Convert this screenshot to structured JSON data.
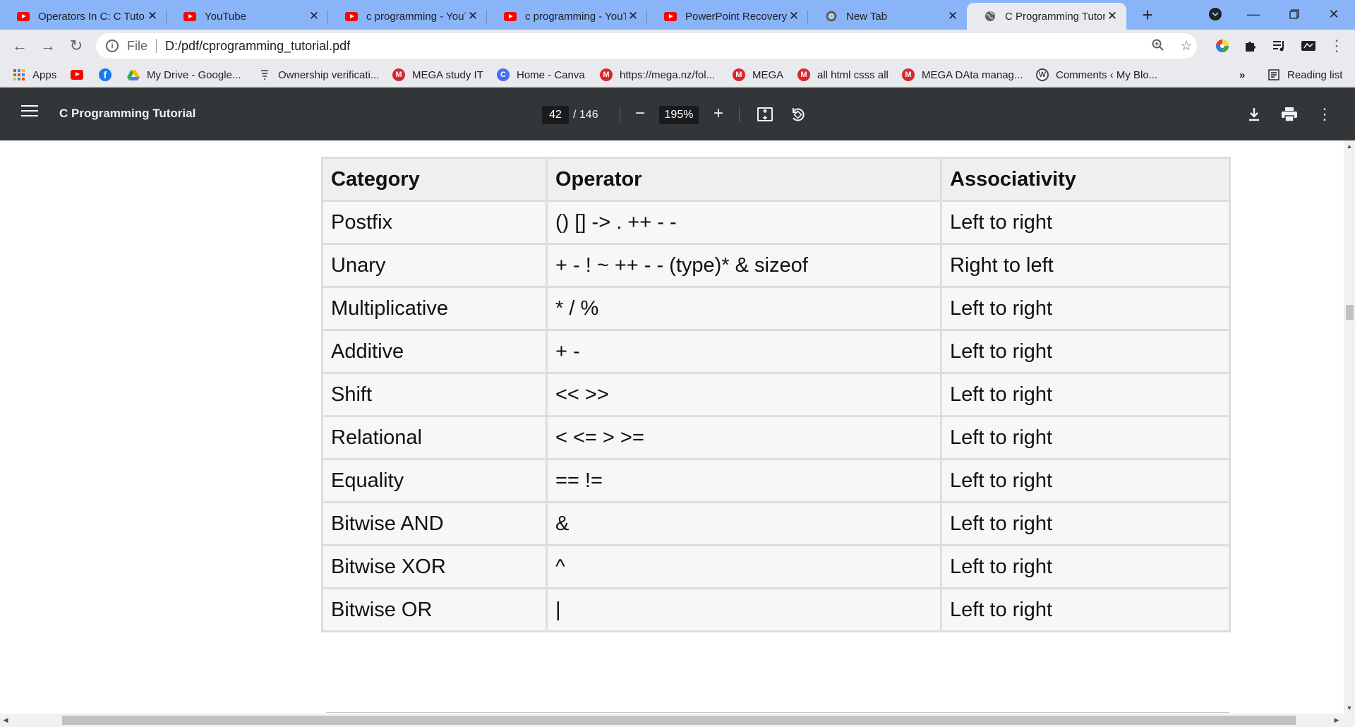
{
  "tabs": [
    {
      "title": "Operators In C: C Tuto",
      "icon": "youtube-icon"
    },
    {
      "title": "YouTube",
      "icon": "youtube-icon"
    },
    {
      "title": "c programming - YouT",
      "icon": "youtube-icon"
    },
    {
      "title": "c programming - YouT",
      "icon": "youtube-icon"
    },
    {
      "title": "PowerPoint Recovery |",
      "icon": "youtube-icon"
    },
    {
      "title": "New Tab",
      "icon": "chrome-icon"
    },
    {
      "title": "C Programming Tutor",
      "icon": "globe-icon",
      "active": true
    }
  ],
  "address": {
    "scheme": "File",
    "url": "D:/pdf/cprogramming_tutorial.pdf"
  },
  "bookmarks": [
    {
      "label": "Apps",
      "icon": "apps-grid-icon"
    },
    {
      "label": "",
      "icon": "youtube-icon"
    },
    {
      "label": "",
      "icon": "facebook-icon"
    },
    {
      "label": "My Drive - Google...",
      "icon": "google-drive-icon"
    },
    {
      "label": "Ownership verificati...",
      "icon": "ownership-icon"
    },
    {
      "label": "MEGA study IT",
      "icon": "mega-icon"
    },
    {
      "label": "Home - Canva",
      "icon": "canva-icon"
    },
    {
      "label": "https://mega.nz/fol...",
      "icon": "mega-icon"
    },
    {
      "label": "MEGA",
      "icon": "mega-icon"
    },
    {
      "label": "all html csss all",
      "icon": "mega-icon"
    },
    {
      "label": "MEGA DAta manag...",
      "icon": "mega-icon"
    },
    {
      "label": "Comments ‹ My Blo...",
      "icon": "wordpress-icon"
    }
  ],
  "bookmarks_overflow": "»",
  "reading_list": "Reading list",
  "pdf": {
    "title": "C Programming Tutorial",
    "page": "42",
    "total": "/ 146",
    "zoom": "195%"
  },
  "table": {
    "headers": [
      "Category",
      "Operator",
      "Associativity"
    ],
    "rows": [
      [
        "Postfix",
        "() [] -> . ++ - -",
        "Left to right"
      ],
      [
        "Unary",
        "+ - ! ~ ++ - - (type)* & sizeof",
        "Right to left"
      ],
      [
        "Multiplicative",
        "* / %",
        "Left to right"
      ],
      [
        "Additive",
        "+ -",
        "Left to right"
      ],
      [
        "Shift",
        "<< >>",
        "Left to right"
      ],
      [
        "Relational",
        "< <= > >=",
        "Left to right"
      ],
      [
        "Equality",
        "== !=",
        "Left to right"
      ],
      [
        "Bitwise AND",
        "&",
        "Left to right"
      ],
      [
        "Bitwise XOR",
        "^",
        "Left to right"
      ],
      [
        "Bitwise OR",
        "|",
        "Left to right"
      ]
    ]
  },
  "colors": {
    "tabstrip": "#8ab4f8",
    "toolbar": "#e8eaed",
    "pdf_header": "#323639"
  }
}
